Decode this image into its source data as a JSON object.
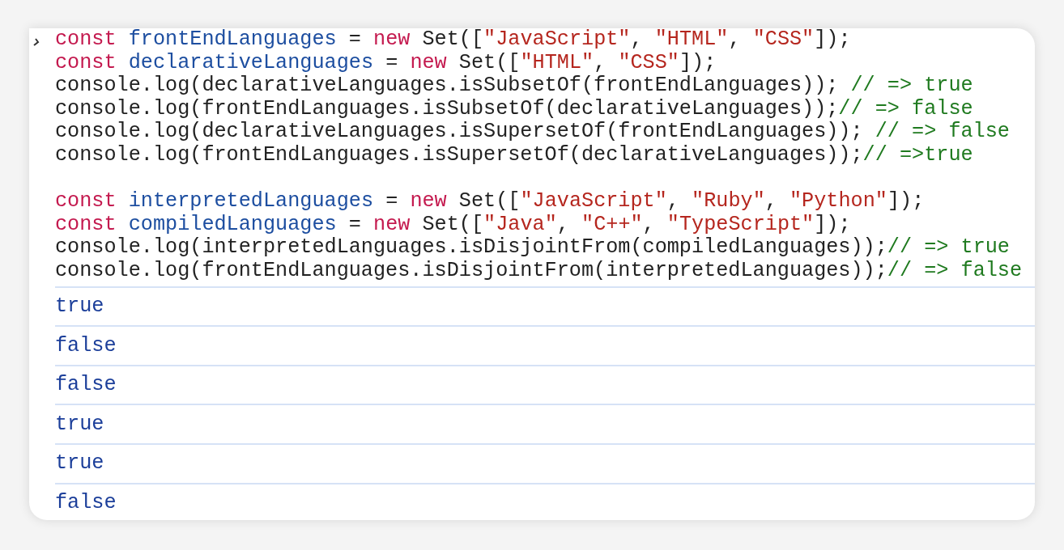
{
  "console": {
    "input_blocks": [
      {
        "lines": [
          {
            "tokens": [
              {
                "kind": "keyword",
                "text": "const "
              },
              {
                "kind": "variable",
                "text": "frontEndLanguages"
              },
              {
                "kind": "plain",
                "text": " = "
              },
              {
                "kind": "keyword",
                "text": "new"
              },
              {
                "kind": "plain",
                "text": " Set(["
              },
              {
                "kind": "string",
                "text": "\"JavaScript\""
              },
              {
                "kind": "plain",
                "text": ", "
              },
              {
                "kind": "string",
                "text": "\"HTML\""
              },
              {
                "kind": "plain",
                "text": ", "
              },
              {
                "kind": "string",
                "text": "\"CSS\""
              },
              {
                "kind": "plain",
                "text": "]);"
              }
            ]
          },
          {
            "tokens": [
              {
                "kind": "keyword",
                "text": "const "
              },
              {
                "kind": "variable",
                "text": "declarativeLanguages"
              },
              {
                "kind": "plain",
                "text": " = "
              },
              {
                "kind": "keyword",
                "text": "new"
              },
              {
                "kind": "plain",
                "text": " Set(["
              },
              {
                "kind": "string",
                "text": "\"HTML\""
              },
              {
                "kind": "plain",
                "text": ", "
              },
              {
                "kind": "string",
                "text": "\"CSS\""
              },
              {
                "kind": "plain",
                "text": "]);"
              }
            ]
          },
          {
            "tokens": [
              {
                "kind": "plain",
                "text": "console.log(declarativeLanguages.isSubsetOf(frontEndLanguages)); "
              },
              {
                "kind": "comment",
                "text": "// => true"
              }
            ]
          },
          {
            "tokens": [
              {
                "kind": "plain",
                "text": "console.log(frontEndLanguages.isSubsetOf(declarativeLanguages));"
              },
              {
                "kind": "comment",
                "text": "// => false"
              }
            ]
          },
          {
            "tokens": [
              {
                "kind": "plain",
                "text": "console.log(declarativeLanguages.isSupersetOf(frontEndLanguages)); "
              },
              {
                "kind": "comment",
                "text": "// => false"
              }
            ]
          },
          {
            "tokens": [
              {
                "kind": "plain",
                "text": "console.log(frontEndLanguages.isSupersetOf(declarativeLanguages));"
              },
              {
                "kind": "comment",
                "text": "// =>true"
              }
            ]
          }
        ]
      },
      {
        "lines": [
          {
            "tokens": [
              {
                "kind": "keyword",
                "text": "const "
              },
              {
                "kind": "variable",
                "text": "interpretedLanguages"
              },
              {
                "kind": "plain",
                "text": " = "
              },
              {
                "kind": "keyword",
                "text": "new"
              },
              {
                "kind": "plain",
                "text": " Set(["
              },
              {
                "kind": "string",
                "text": "\"JavaScript\""
              },
              {
                "kind": "plain",
                "text": ", "
              },
              {
                "kind": "string",
                "text": "\"Ruby\""
              },
              {
                "kind": "plain",
                "text": ", "
              },
              {
                "kind": "string",
                "text": "\"Python\""
              },
              {
                "kind": "plain",
                "text": "]);"
              }
            ]
          },
          {
            "tokens": [
              {
                "kind": "keyword",
                "text": "const "
              },
              {
                "kind": "variable",
                "text": "compiledLanguages"
              },
              {
                "kind": "plain",
                "text": " = "
              },
              {
                "kind": "keyword",
                "text": "new"
              },
              {
                "kind": "plain",
                "text": " Set(["
              },
              {
                "kind": "string",
                "text": "\"Java\""
              },
              {
                "kind": "plain",
                "text": ", "
              },
              {
                "kind": "string",
                "text": "\"C++\""
              },
              {
                "kind": "plain",
                "text": ", "
              },
              {
                "kind": "string",
                "text": "\"TypeScript\""
              },
              {
                "kind": "plain",
                "text": "]);"
              }
            ]
          },
          {
            "tokens": [
              {
                "kind": "plain",
                "text": "console.log(interpretedLanguages.isDisjointFrom(compiledLanguages));"
              },
              {
                "kind": "comment",
                "text": "// => true"
              }
            ]
          },
          {
            "tokens": [
              {
                "kind": "plain",
                "text": "console.log(frontEndLanguages.isDisjointFrom(interpretedLanguages));"
              },
              {
                "kind": "comment",
                "text": "// => false"
              }
            ]
          }
        ]
      }
    ],
    "outputs": [
      "true",
      "false",
      "false",
      "true",
      "true",
      "false"
    ]
  }
}
